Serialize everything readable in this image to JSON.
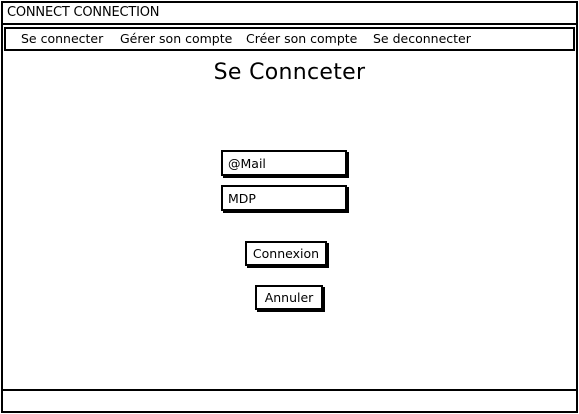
{
  "window": {
    "title": "CONNECT CONNECTION"
  },
  "menu": {
    "items": [
      {
        "label": "Se connecter"
      },
      {
        "label": "Gérer son compte"
      },
      {
        "label": "Créer son compte"
      },
      {
        "label": "Se deconnecter"
      }
    ]
  },
  "main": {
    "title": "Se Connceter"
  },
  "form": {
    "email_placeholder": "@Mail",
    "password_placeholder": "MDP",
    "submit_label": "Connexion",
    "cancel_label": "Annuler"
  }
}
